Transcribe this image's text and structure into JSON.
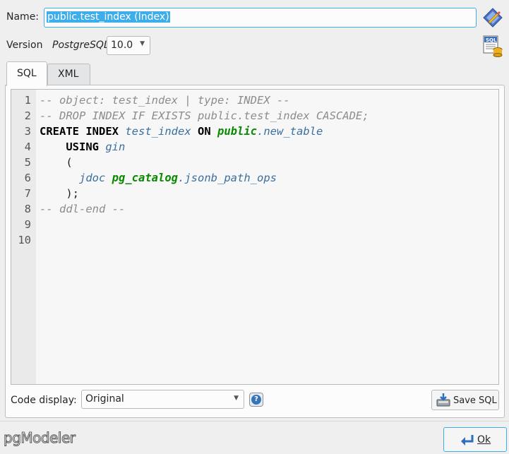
{
  "name": {
    "label": "Name:",
    "value": "public.test_index (Index)"
  },
  "version": {
    "label": "Version",
    "dbms": "PostgreSQL",
    "selected": "10.0"
  },
  "tabs": [
    {
      "label": "SQL",
      "active": true
    },
    {
      "label": "XML",
      "active": false
    }
  ],
  "editor": {
    "line_numbers": [
      "1",
      "2",
      "3",
      "4",
      "5",
      "6",
      "7",
      "8",
      "9",
      "10"
    ]
  },
  "code_display": {
    "label": "Code display:",
    "selected": "Original"
  },
  "buttons": {
    "save_sql": "Save SQL",
    "ok": "Ok"
  },
  "logo": "pgModeler",
  "icons": {
    "object": "index-object-icon",
    "sql_source": "sql-source-icon",
    "help": "help-icon",
    "save": "save-icon",
    "ok": "enter-arrow-icon"
  },
  "colors": {
    "accent": "#3daee9",
    "keyword": "#000000",
    "comment": "#8c8c8c",
    "identifier": "#3b6fa0",
    "schema": "#098a00"
  }
}
